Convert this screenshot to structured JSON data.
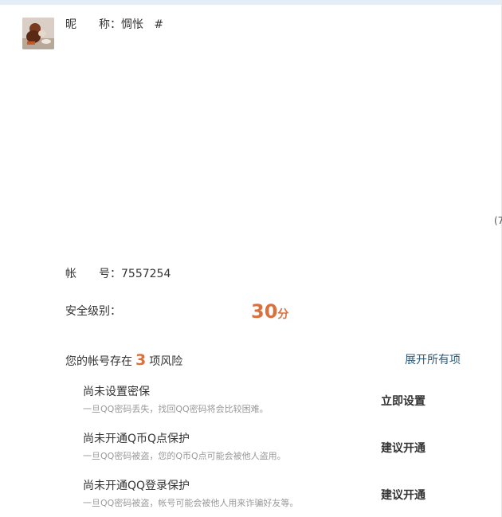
{
  "profile": {
    "nickname_label": "昵　称：",
    "nickname_label_a": "昵",
    "nickname_label_b": "称：",
    "nickname_value": "惆怅",
    "nickname_suffix": "#"
  },
  "side_clip": "(7",
  "account": {
    "label_a": "帐",
    "label_b": "号：",
    "value": "7557254"
  },
  "security": {
    "label": "安全级别：",
    "score": "30",
    "score_unit": "分"
  },
  "risks": {
    "prefix": "您的帐号存在",
    "count": "3",
    "suffix": "项风险",
    "expand_label": "展开所有项",
    "items": [
      {
        "title": "尚未设置密保",
        "desc": "一旦QQ密码丢失，找回QQ密码将会比较困难。",
        "action": "立即设置"
      },
      {
        "title": "尚未开通Q币Q点保护",
        "desc": "一旦QQ密码被盗，您的Q币Q点可能会被他人盗用。",
        "action": "建议开通"
      },
      {
        "title": "尚未开通QQ登录保护",
        "desc": "一旦QQ密码被盗，帐号可能会被他人用来诈骗好友等。",
        "action": "建议开通"
      }
    ]
  },
  "colors": {
    "accent": "#d9713e",
    "link": "#2b5a7a",
    "muted": "#999999",
    "top_band": "#e3eef8"
  }
}
